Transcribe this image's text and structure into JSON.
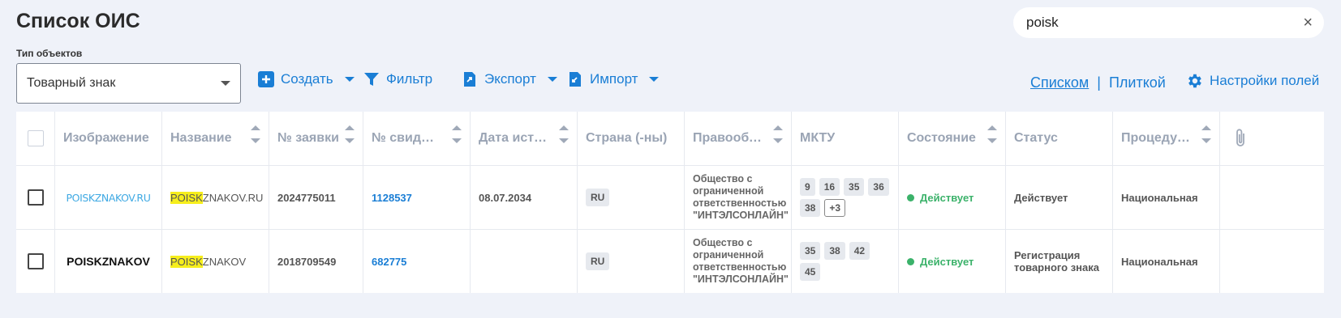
{
  "page": {
    "title": "Список ОИС"
  },
  "search": {
    "value": "poisk",
    "clear": "×"
  },
  "object_type": {
    "label": "Тип объектов",
    "value": "Товарный знак"
  },
  "toolbar": {
    "create": "Создать",
    "filter": "Фильтр",
    "export": "Экспорт",
    "import": "Импорт"
  },
  "views": {
    "list": "Списком",
    "separator": "|",
    "tile": "Плиткой"
  },
  "settings": {
    "label": "Настройки полей"
  },
  "table": {
    "headers": {
      "image": "Изображение",
      "name": "Название",
      "app_no": "№ заявки",
      "cert_no": "№ свидете…",
      "expiry": "Дата истеч…",
      "country": "Страна (-ны)",
      "owner": "Правообла…",
      "mktu": "МКТУ",
      "state": "Состояние",
      "status": "Статус",
      "procedure": "Процедура…"
    },
    "rows": [
      {
        "logo": "POISKZNAKOV.RU",
        "name_hl": "POISK",
        "name_rest": "ZNAKOV.RU",
        "app_no": "2024775011",
        "cert_no": "1128537",
        "expiry": "08.07.2034",
        "country": "RU",
        "owner": "Общество с ограниченной ответственностью \"ИНТЭЛСОНЛАЙН\"",
        "mktu": [
          "9",
          "16",
          "35",
          "36",
          "38"
        ],
        "mktu_more": "+3",
        "state": "Действует",
        "status": "Действует",
        "procedure": "Национальная"
      },
      {
        "logo": "POISKZNAKOV",
        "name_hl": "POISK",
        "name_rest": "ZNAKOV",
        "app_no": "2018709549",
        "cert_no": "682775",
        "expiry": "",
        "country": "RU",
        "owner": "Общество с ограниченной ответственностью \"ИНТЭЛСОНЛАЙН\"",
        "mktu": [
          "35",
          "38",
          "42",
          "45"
        ],
        "mktu_more": "",
        "state": "Действует",
        "status": "Регистрация товарного знака",
        "procedure": "Национальная"
      }
    ]
  },
  "colors": {
    "accent": "#1a7ed5",
    "active": "#3bb26a",
    "highlight": "#f6ee1c",
    "background": "#eff2f9"
  }
}
